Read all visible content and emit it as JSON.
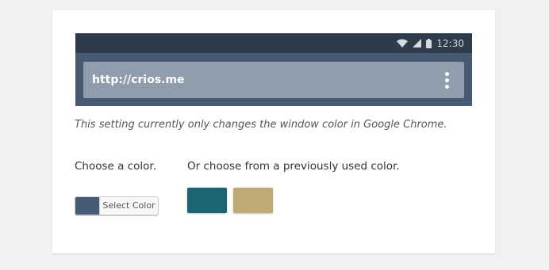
{
  "preview": {
    "status_time": "12:30",
    "url": "http://crios.me",
    "colors": {
      "statusbar": "#2d3b4b",
      "toolbar": "#465b73",
      "omnibox": "#8f9dac"
    }
  },
  "note": "This setting currently only changes the window color in Google Chrome.",
  "choose": {
    "label": "Choose a color.",
    "button_label": "Select Color",
    "current_color": "#465b73"
  },
  "previous": {
    "label": "Or choose from a previously used color.",
    "swatches": [
      "#1a6474",
      "#bea977"
    ]
  }
}
